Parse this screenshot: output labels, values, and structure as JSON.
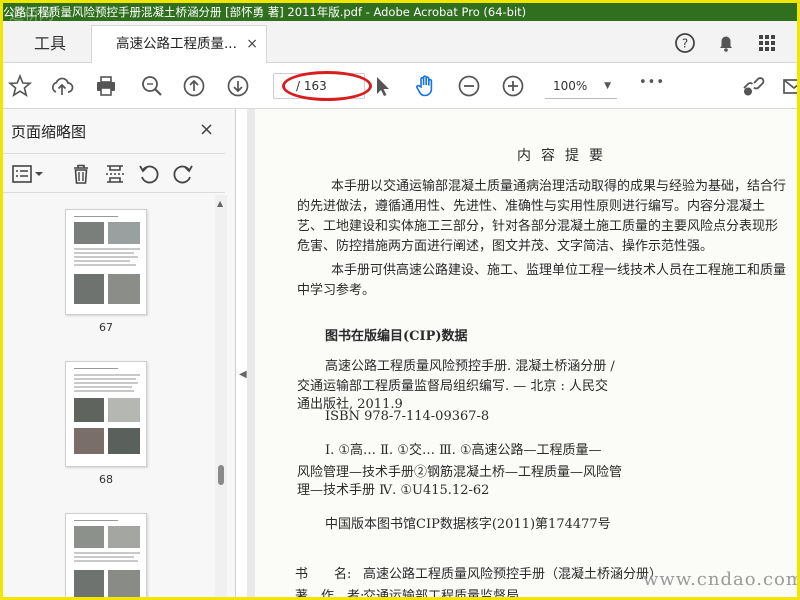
{
  "window": {
    "title": "公路工程质量风险预控手册混凝土桥涵分册 [部怀勇 著] 2011年版.pdf - Adobe Acrobat Pro (64-bit)",
    "watermark_logo": "道桥网"
  },
  "tabs": {
    "tools_label": "工具",
    "document_label": "高速公路工程质量...",
    "close_symbol": "×"
  },
  "toolbar": {
    "page_input": "",
    "page_total": "/ 163",
    "zoom": "100%",
    "more": "•••"
  },
  "panel": {
    "title": "页面缩略图",
    "close_symbol": "×",
    "thumbnails": [
      {
        "page": "67"
      },
      {
        "page": "68"
      },
      {
        "page": ""
      }
    ]
  },
  "document": {
    "heading": "内容提要",
    "lines": [
      "本手册以交通运输部混凝土质量通病治理活动取得的成果与经验为基础，结合行",
      "的先进做法，遵循通用性、先进性、准确性与实用性原则进行编写。内容分混凝土",
      "艺、工地建设和实体施工三部分，针对各部分混凝土施工质量的主要风险点分表现形",
      "危害、防控措施两方面进行阐述，图文并茂、文字简洁、操作示范性强。",
      "本手册可供高速公路建设、施工、监理单位工程一线技术人员在工程施工和质量",
      "中学习参考。"
    ],
    "cip_title": "图书在版编目(CIP)数据",
    "cip_lines": [
      "高速公路工程质量风险预控手册. 混凝土桥涵分册 /",
      "交通运输部工程质量监督局组织编写. — 北京 : 人民交",
      "通出版社, 2011.9",
      "ISBN 978-7-114-09367-8",
      "Ⅰ. ①高… Ⅱ. ①交… Ⅲ. ①高速公路—工程质量—",
      "风险管理—技术手册②钢筋混凝土桥—工程质量—风险管",
      "理—技术手册 Ⅳ. ①U415.12-62",
      "中国版本图书馆CIP数据核字(2011)第174477号"
    ],
    "book_label": "书　　名:",
    "book_value": "高速公路工程质量风险预控手册（混凝土桥涵分册）",
    "author_label": "著　作　者:",
    "author_value": "交通运输部工程质量监督局",
    "watermark": "www.cndao.com"
  },
  "colors": {
    "titlebar": "#2f6f1e",
    "highlight_ellipse": "#d81d1d",
    "screenshot_border": "#f2e600",
    "acrobat_blue": "#1473e6"
  },
  "icons": {
    "toolbar": [
      "star-icon",
      "cloud-upload-icon",
      "print-icon",
      "zoom-search-icon",
      "page-up-icon",
      "page-down-icon",
      "select-cursor-icon",
      "hand-tool-icon",
      "zoom-out-icon",
      "zoom-in-icon",
      "more-icon",
      "share-link-icon",
      "mail-icon"
    ],
    "tabbar": [
      "help-icon",
      "bell-icon",
      "apps-grid-icon"
    ],
    "panel": [
      "thumbnail-options-icon",
      "delete-icon",
      "extract-icon",
      "rotate-ccw-icon",
      "rotate-cw-icon"
    ]
  }
}
